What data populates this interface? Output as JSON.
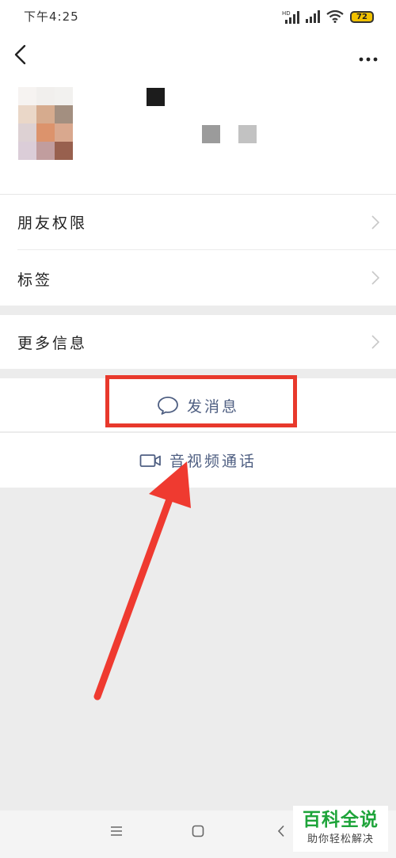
{
  "status_bar": {
    "time": "下午4:25",
    "battery": "72",
    "icons": [
      "signal-hd-icon",
      "signal-icon",
      "wifi-icon",
      "battery-icon"
    ]
  },
  "nav": {
    "back_icon": "back-chevron-icon",
    "more_icon": "more-dots-icon"
  },
  "menu": {
    "friend_permissions": "朋友权限",
    "tags": "标签",
    "more_info": "更多信息"
  },
  "actions": {
    "send_message": "发消息",
    "av_call": "音视频通话"
  },
  "watermark": {
    "title": "百科全说",
    "subtitle": "助你轻松解决"
  },
  "colors": {
    "action_text": "#4f5f82",
    "highlight": "#e8392c",
    "watermark_green": "#1ea43a"
  }
}
